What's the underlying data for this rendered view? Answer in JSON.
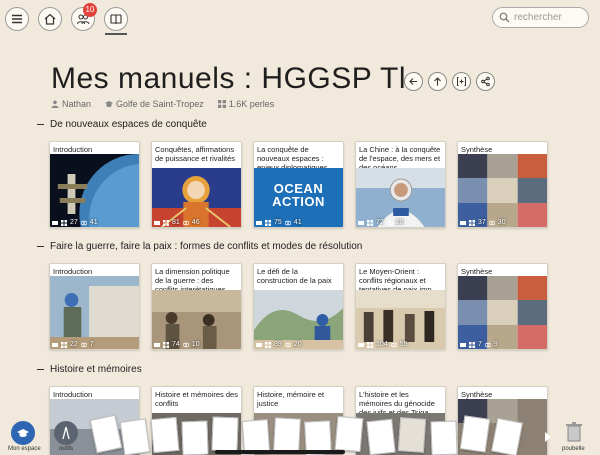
{
  "topbar": {
    "notification_count": "10",
    "search_placeholder": "rechercher"
  },
  "header": {
    "title": "Mes manuels : HGGSP Tle",
    "publisher": "Nathan",
    "school": "Golfe de Saint-Tropez",
    "pearls": "1.6K perles"
  },
  "sections": [
    {
      "title": "De nouveaux espaces de conquête",
      "cards": [
        {
          "label": "Introduction",
          "s1": "27",
          "s2": "41"
        },
        {
          "label": "Conquêtes, affirmations de puissance et rivalités",
          "s1": "81",
          "s2": "46"
        },
        {
          "label": "La conquête de nouveaux espaces : enjeux diplomatiques ...",
          "s1": "75",
          "s2": "41",
          "overlay": "OCEAN ACTION"
        },
        {
          "label": "La Chine : à la conquête de l'espace, des mers et des océans",
          "s1": "72",
          "s2": "28"
        },
        {
          "label": "Synthèse",
          "s1": "37",
          "s2": "30"
        }
      ]
    },
    {
      "title": "Faire la guerre, faire la paix : formes de conflits et modes de résolution",
      "cards": [
        {
          "label": "Introduction",
          "s1": "22",
          "s2": "7"
        },
        {
          "label": "La dimension politique de la guerre : des conflits interétatiques ...",
          "s1": "74",
          "s2": "10"
        },
        {
          "label": "Le défi de la construction de la paix",
          "s1": "89",
          "s2": "20"
        },
        {
          "label": "Le Moyen-Orient : conflits régionaux et tentatives de paix imp...",
          "s1": "104",
          "s2": "55"
        },
        {
          "label": "Synthèse",
          "s1": "7",
          "s2": "9"
        }
      ]
    },
    {
      "title": "Histoire et mémoires",
      "cards": [
        {
          "label": "Introduction"
        },
        {
          "label": "Histoire et mémoires des conflits"
        },
        {
          "label": "Histoire, mémoire et justice"
        },
        {
          "label": "L'histoire et les mémoires du génocide des juifs et des Tsiga..."
        },
        {
          "label": "Synthèse"
        }
      ]
    }
  ],
  "bottombar": {
    "my_space": "Mon espace",
    "tools": "outils",
    "trash": "poubelle"
  }
}
